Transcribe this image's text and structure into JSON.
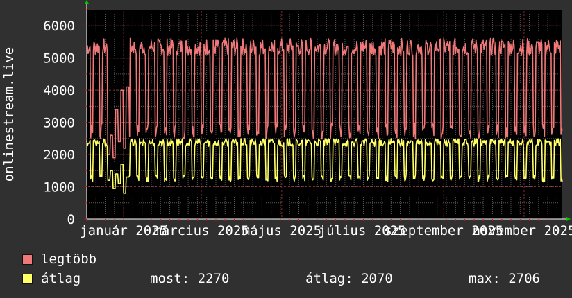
{
  "chart_data": {
    "type": "line",
    "ylabel": "onlinestream.live",
    "ylim": [
      0,
      6500
    ],
    "yticks": [
      0,
      1000,
      2000,
      3000,
      4000,
      5000,
      6000
    ],
    "x_tick_labels": [
      "január 2025",
      "március 2025",
      "május 2025",
      "július 2025",
      "szeptember 2025",
      "november 2025"
    ],
    "x_start": "2024-12-04",
    "x_end": "2025-11-30",
    "x_tick_dates": [
      "2025-01-01",
      "2025-03-01",
      "2025-05-01",
      "2025-07-01",
      "2025-09-01",
      "2025-11-01"
    ],
    "series": [
      {
        "name": "legtöbb",
        "color": "#f07878",
        "weekday_value": 5400,
        "weekend_value": 2700,
        "holiday_period": {
          "from": "2024-12-20",
          "to": "2025-01-05",
          "values": [
            2000,
            2600,
            1900,
            3400,
            2400,
            4000,
            2200,
            4100
          ]
        }
      },
      {
        "name": "átlag",
        "color": "#ffff66",
        "weekday_value": 2400,
        "weekend_value": 1250,
        "holiday_period": {
          "from": "2024-12-20",
          "to": "2025-01-05",
          "values": [
            1200,
            1500,
            950,
            1400,
            1100,
            1700,
            800,
            1300
          ]
        }
      }
    ],
    "grid": true,
    "legend_position": "bottom-left"
  },
  "legend": {
    "items": [
      {
        "label": "legtöbb",
        "color": "#f07878"
      },
      {
        "label": "átlag",
        "color": "#ffff66"
      }
    ],
    "stats": {
      "most": "most: 2270",
      "atlag": "átlag: 2070",
      "max": "max: 2706"
    }
  },
  "colors": {
    "background": "#303030",
    "plot_background": "#000000",
    "grid_major": "#8a2a2a",
    "axis": "#ff0000",
    "arrow": "#00cc00"
  }
}
